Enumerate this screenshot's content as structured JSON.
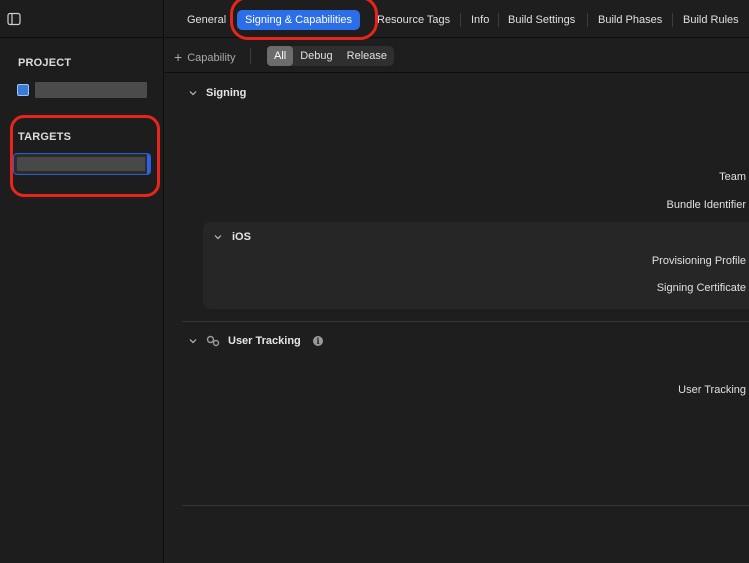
{
  "navigator": {
    "project_header": "PROJECT",
    "targets_header": "TARGETS"
  },
  "tabs": [
    {
      "label": "General"
    },
    {
      "label": "Signing & Capabilities",
      "active": true
    },
    {
      "label": "Resource Tags"
    },
    {
      "label": "Info"
    },
    {
      "label": "Build Settings"
    },
    {
      "label": "Build Phases"
    },
    {
      "label": "Build Rules"
    }
  ],
  "filterbar": {
    "add_capability": "Capability",
    "segments": [
      "All",
      "Debug",
      "Release"
    ],
    "selected_segment": "All"
  },
  "signing": {
    "title": "Signing",
    "team_label": "Team",
    "bundle_identifier_label": "Bundle Identifier",
    "ios": {
      "title": "iOS",
      "provisioning_profile_label": "Provisioning Profile",
      "signing_certificate_label": "Signing Certificate"
    }
  },
  "user_tracking": {
    "title": "User Tracking",
    "row_label": "User Tracking"
  },
  "colors": {
    "accent": "#2c6ee8",
    "annotation": "#e8251c",
    "background": "#1e1e1e"
  }
}
